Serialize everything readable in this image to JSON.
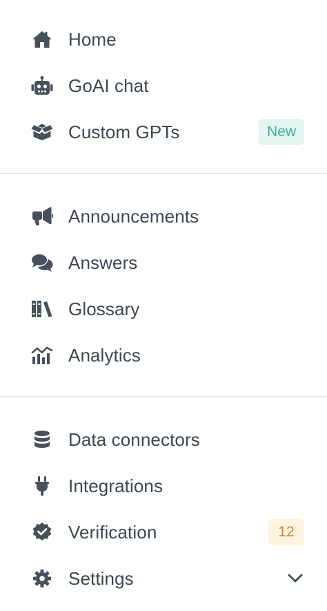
{
  "colors": {
    "text": "#3d4653",
    "icon": "#47505c",
    "divider": "#e3e5e8",
    "new_badge_bg": "#e3f5f1",
    "new_badge_text": "#3fae97",
    "count_badge_bg": "#fdf3df",
    "count_badge_text": "#c68a1f"
  },
  "section1": {
    "home": {
      "label": "Home",
      "icon": "home-icon"
    },
    "goai_chat": {
      "label": "GoAI chat",
      "icon": "robot-icon"
    },
    "custom_gpts": {
      "label": "Custom GPTs",
      "icon": "box-open-icon",
      "badge": "New"
    }
  },
  "section2": {
    "announcements": {
      "label": "Announcements",
      "icon": "megaphone-icon"
    },
    "answers": {
      "label": "Answers",
      "icon": "comments-icon"
    },
    "glossary": {
      "label": "Glossary",
      "icon": "books-icon"
    },
    "analytics": {
      "label": "Analytics",
      "icon": "chart-mixed-icon"
    }
  },
  "section3": {
    "data_connectors": {
      "label": "Data connectors",
      "icon": "database-icon"
    },
    "integrations": {
      "label": "Integrations",
      "icon": "plug-icon"
    },
    "verification": {
      "label": "Verification",
      "icon": "badge-check-icon",
      "count": "12"
    },
    "settings": {
      "label": "Settings",
      "icon": "gear-icon",
      "expand_icon": "chevron-down-icon"
    }
  }
}
